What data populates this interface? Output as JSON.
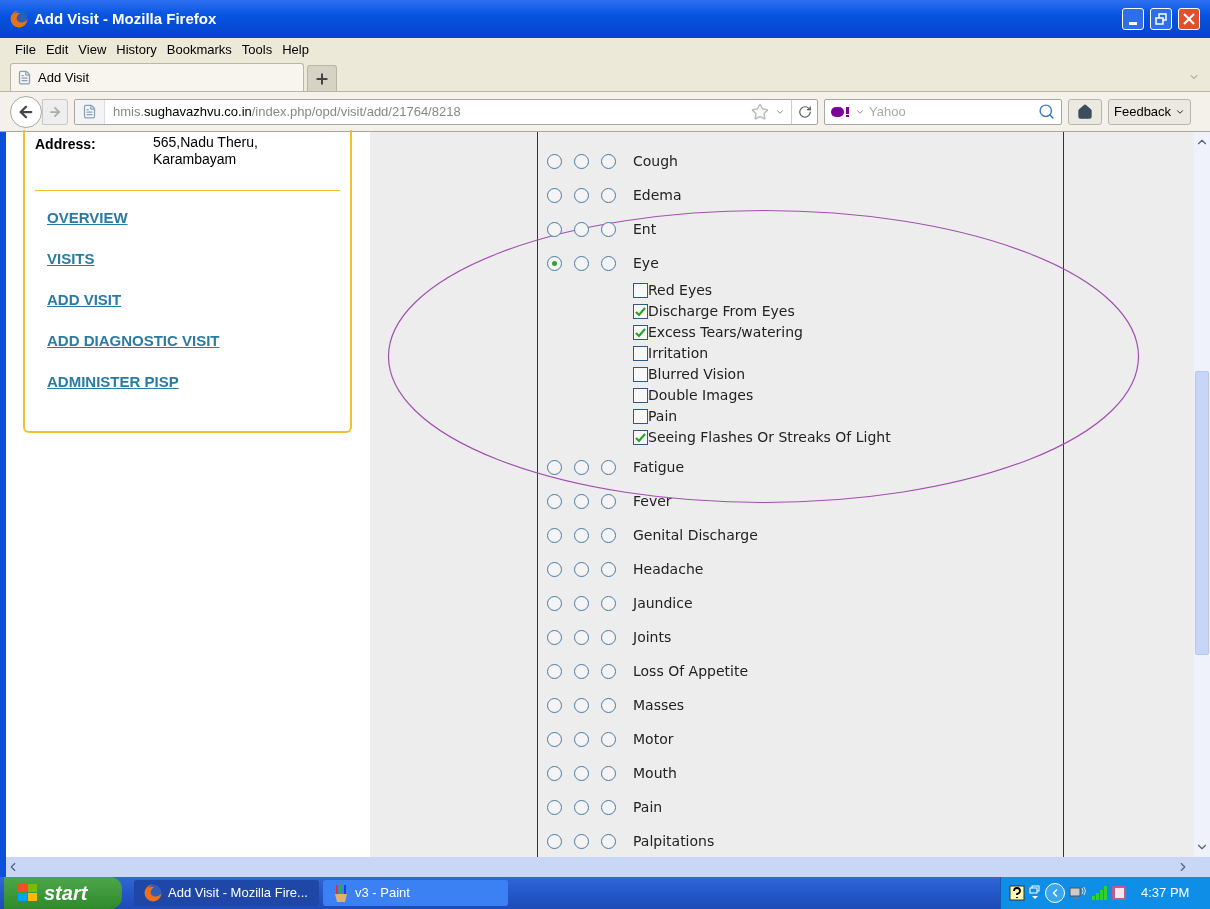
{
  "window": {
    "title": "Add Visit - Mozilla Firefox"
  },
  "menu": [
    "File",
    "Edit",
    "View",
    "History",
    "Bookmarks",
    "Tools",
    "Help"
  ],
  "tabs": [
    {
      "label": "Add Visit",
      "selected": true
    }
  ],
  "address_bar": {
    "host_prefix": "hmis.",
    "domain": "sughavazhvu.co.in",
    "path": "/index.php/opd/visit/add/21764/8218"
  },
  "search": {
    "placeholder": "Yahoo"
  },
  "feedback_button": "Feedback",
  "patient": {
    "label": "Address:",
    "lines": [
      "565,Nadu Theru,",
      "Karambayam"
    ]
  },
  "links": [
    "OVERVIEW",
    "VISITS",
    "ADD VISIT",
    "ADD DIAGNOSTIC VISIT",
    "ADMINISTER PISP"
  ],
  "symptoms": [
    {
      "label": "Cough",
      "options": [
        {
          "selected": false
        },
        {
          "selected": false
        },
        {
          "selected": false
        }
      ]
    },
    {
      "label": "Edema",
      "options": [
        {
          "selected": false
        },
        {
          "selected": false
        },
        {
          "selected": false
        }
      ]
    },
    {
      "label": "Ent",
      "options": [
        {
          "selected": false
        },
        {
          "selected": false
        },
        {
          "selected": false
        }
      ]
    },
    {
      "label": "Eye",
      "options": [
        {
          "selected": true
        },
        {
          "selected": false
        },
        {
          "selected": false
        }
      ],
      "children": [
        {
          "label": "Red Eyes",
          "checked": false
        },
        {
          "label": "Discharge From Eyes",
          "checked": true
        },
        {
          "label": "Excess Tears/watering",
          "checked": true
        },
        {
          "label": "Irritation",
          "checked": false
        },
        {
          "label": "Blurred Vision",
          "checked": false
        },
        {
          "label": "Double Images",
          "checked": false
        },
        {
          "label": "Pain",
          "checked": false
        },
        {
          "label": "Seeing Flashes Or Streaks Of Light",
          "checked": true
        }
      ]
    },
    {
      "label": "Fatigue",
      "options": [
        {
          "selected": false
        },
        {
          "selected": false
        },
        {
          "selected": false
        }
      ]
    },
    {
      "label": "Fever",
      "options": [
        {
          "selected": false
        },
        {
          "selected": false
        },
        {
          "selected": false
        }
      ]
    },
    {
      "label": "Genital Discharge",
      "options": [
        {
          "selected": false
        },
        {
          "selected": false
        },
        {
          "selected": false
        }
      ]
    },
    {
      "label": "Headache",
      "options": [
        {
          "selected": false
        },
        {
          "selected": false
        },
        {
          "selected": false
        }
      ]
    },
    {
      "label": "Jaundice",
      "options": [
        {
          "selected": false
        },
        {
          "selected": false
        },
        {
          "selected": false
        }
      ]
    },
    {
      "label": "Joints",
      "options": [
        {
          "selected": false
        },
        {
          "selected": false
        },
        {
          "selected": false
        }
      ]
    },
    {
      "label": "Loss Of Appetite",
      "options": [
        {
          "selected": false
        },
        {
          "selected": false
        },
        {
          "selected": false
        }
      ]
    },
    {
      "label": "Masses",
      "options": [
        {
          "selected": false
        },
        {
          "selected": false
        },
        {
          "selected": false
        }
      ]
    },
    {
      "label": "Motor",
      "options": [
        {
          "selected": false
        },
        {
          "selected": false
        },
        {
          "selected": false
        }
      ]
    },
    {
      "label": "Mouth",
      "options": [
        {
          "selected": false
        },
        {
          "selected": false
        },
        {
          "selected": false
        }
      ]
    },
    {
      "label": "Pain",
      "options": [
        {
          "selected": false
        },
        {
          "selected": false
        },
        {
          "selected": false
        }
      ]
    },
    {
      "label": "Palpitations",
      "options": [
        {
          "selected": false
        },
        {
          "selected": false
        },
        {
          "selected": false
        }
      ]
    }
  ],
  "taskbar": {
    "start": "start",
    "tasks": [
      {
        "label": "Add Visit - Mozilla Fire...",
        "selected": true,
        "kind": "browser"
      },
      {
        "label": "v3 - Paint",
        "selected": false,
        "kind": "paint"
      }
    ],
    "clock": "4:37 PM"
  }
}
